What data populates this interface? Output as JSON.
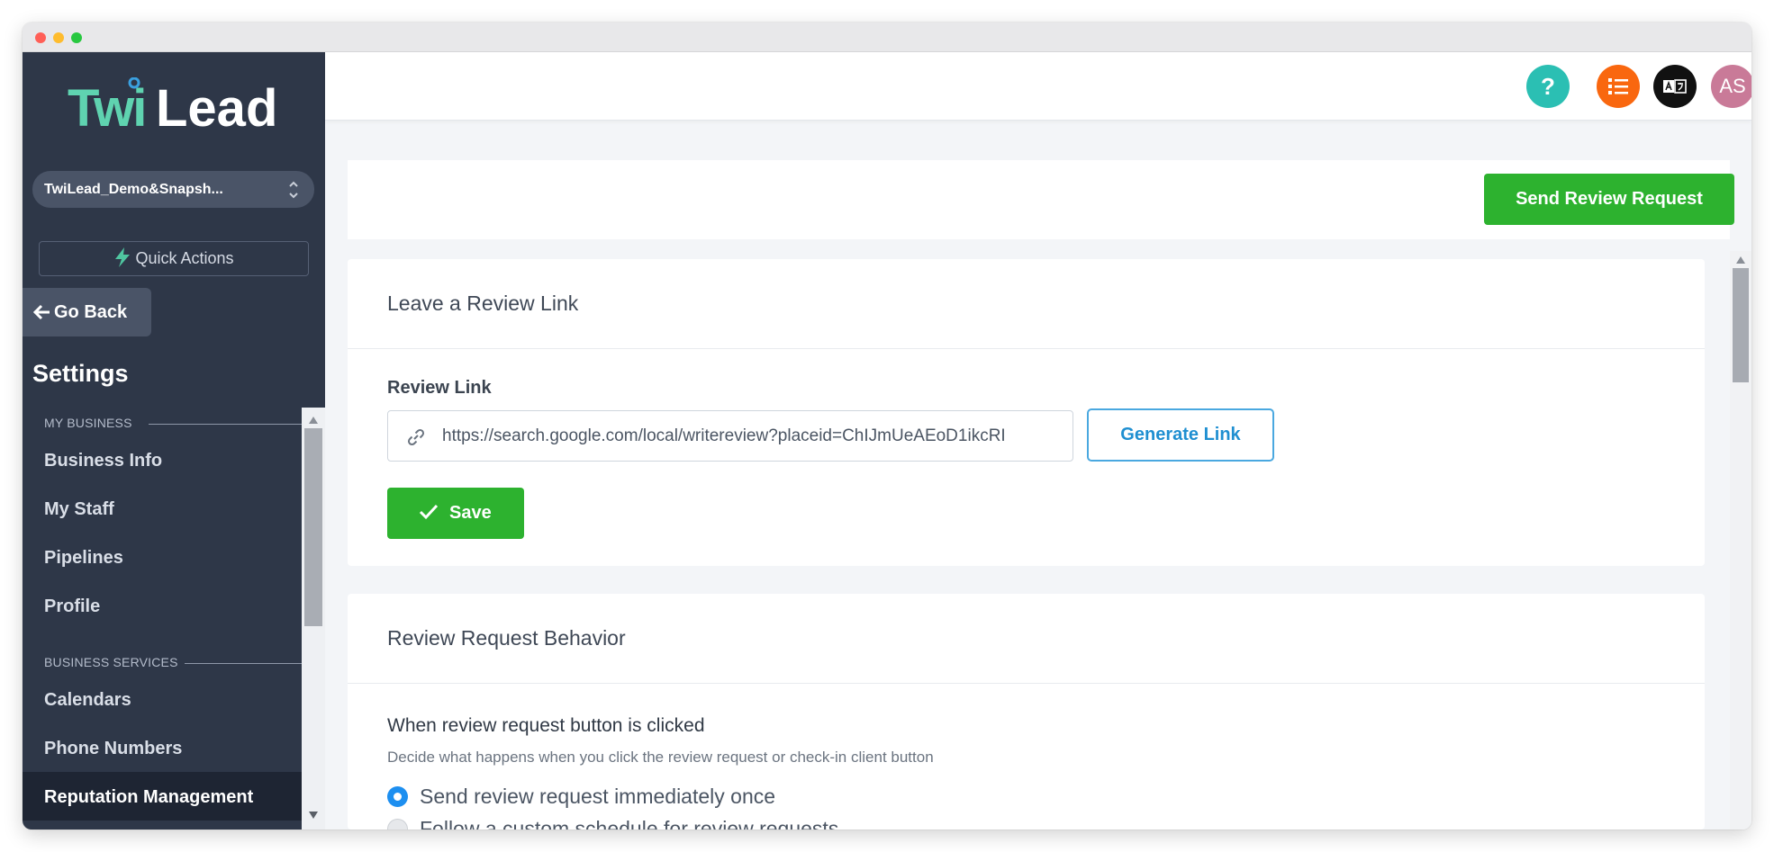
{
  "brand": {
    "logo_text": "TwiLead",
    "logo_color": "#5fd3b0"
  },
  "sidebar": {
    "account_name": "TwiLead_Demo&Snapsh...",
    "quick_actions": "Quick Actions",
    "go_back": "Go Back",
    "settings_title": "Settings",
    "sections": [
      {
        "label": "MY BUSINESS",
        "items": [
          "Business Info",
          "My Staff",
          "Pipelines",
          "Profile"
        ]
      },
      {
        "label": "BUSINESS SERVICES",
        "items": [
          "Calendars",
          "Phone Numbers",
          "Reputation Management"
        ]
      }
    ],
    "active_item": "Reputation Management"
  },
  "topbar": {
    "help_icon": "question-icon",
    "tasks_icon": "list-icon",
    "language_icon": "translate-icon",
    "avatar_initials": "AS"
  },
  "actions": {
    "send_review_request": "Send Review Request"
  },
  "review_link_card": {
    "title": "Leave a Review Link",
    "field_label": "Review Link",
    "link_value": "https://search.google.com/local/writereview?placeid=ChIJmUeAEoD1ikcRI",
    "generate_label": "Generate Link",
    "save_label": "Save"
  },
  "behavior_card": {
    "title": "Review Request Behavior",
    "subtitle": "When review request button is clicked",
    "description": "Decide what happens when you click the review request or check-in client button",
    "options": [
      {
        "label": "Send review request immediately once",
        "selected": true
      },
      {
        "label": "Follow a custom schedule for review requests",
        "selected": false
      }
    ]
  },
  "colors": {
    "sidebar": "#2e3748",
    "primary_green": "#2db22f",
    "link_blue": "#1f8fd1"
  }
}
